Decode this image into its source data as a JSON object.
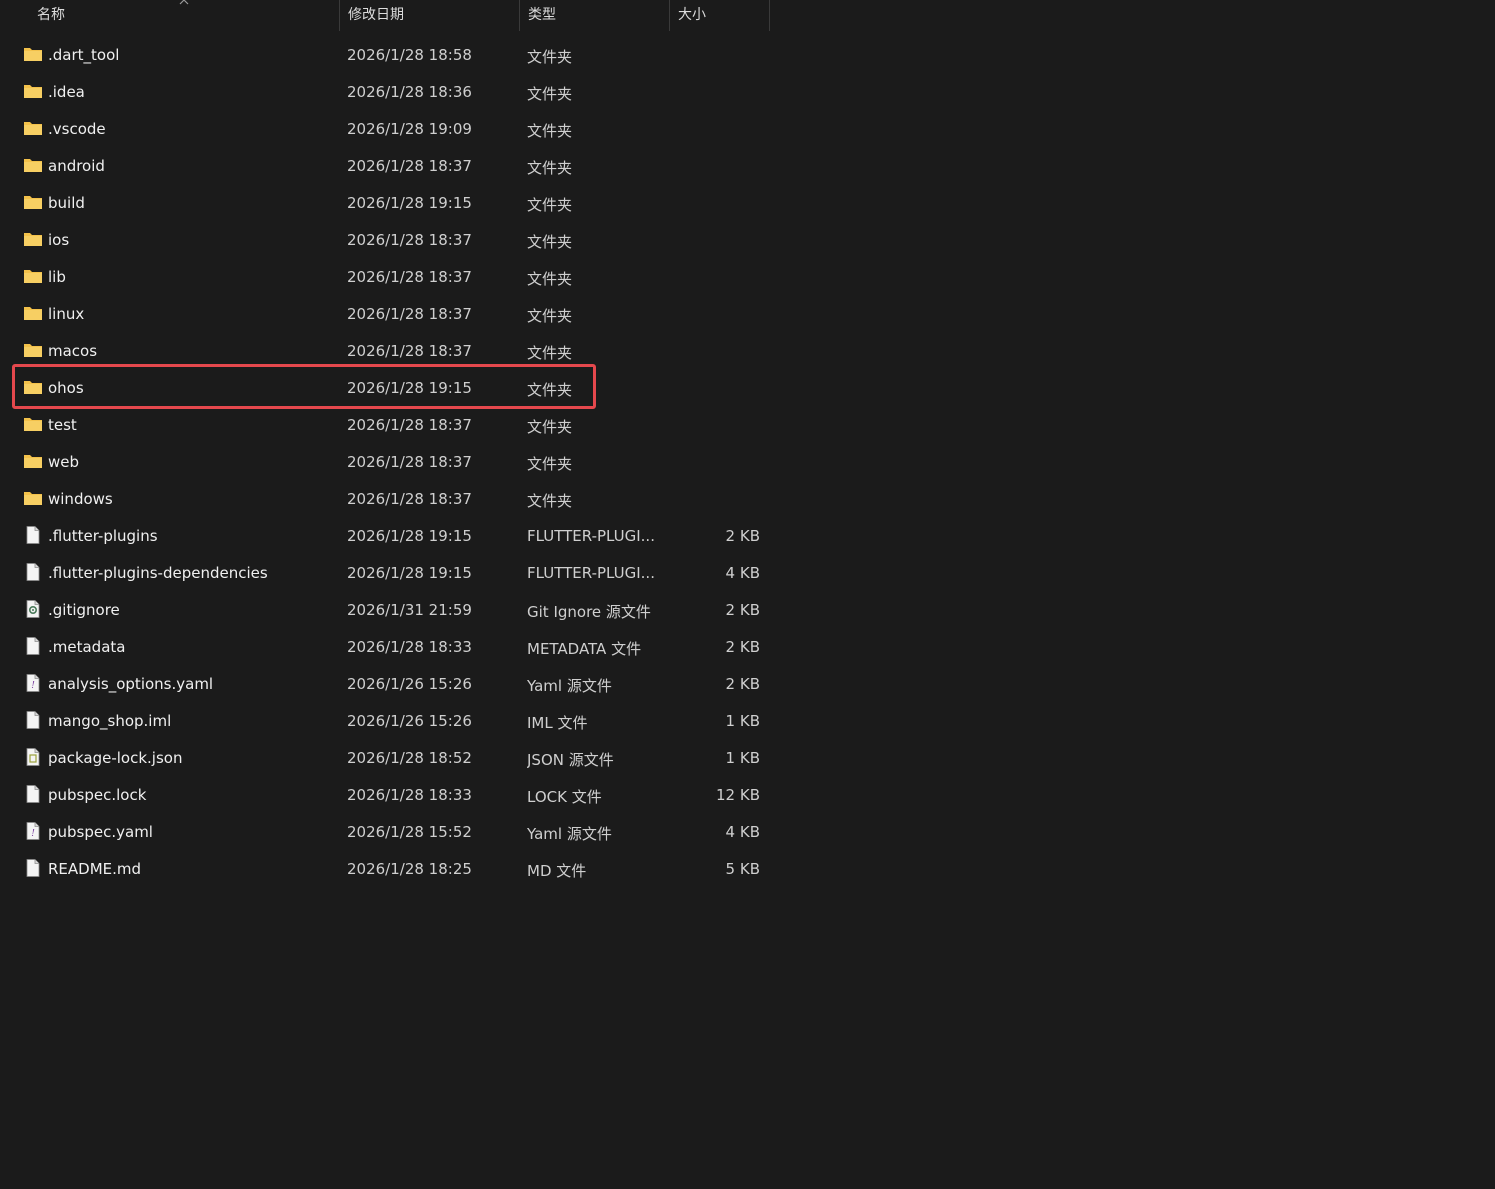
{
  "columns": {
    "name": "名称",
    "date": "修改日期",
    "type": "类型",
    "size": "大小"
  },
  "highlight_color": "#e5484d",
  "folder_color": "#f3c14a",
  "files": [
    {
      "name": ".dart_tool",
      "date": "2026/1/28 18:58",
      "type": "文件夹",
      "size": "",
      "icon": "folder-icon"
    },
    {
      "name": ".idea",
      "date": "2026/1/28 18:36",
      "type": "文件夹",
      "size": "",
      "icon": "folder-icon"
    },
    {
      "name": ".vscode",
      "date": "2026/1/28 19:09",
      "type": "文件夹",
      "size": "",
      "icon": "folder-icon"
    },
    {
      "name": "android",
      "date": "2026/1/28 18:37",
      "type": "文件夹",
      "size": "",
      "icon": "folder-icon"
    },
    {
      "name": "build",
      "date": "2026/1/28 19:15",
      "type": "文件夹",
      "size": "",
      "icon": "folder-icon"
    },
    {
      "name": "ios",
      "date": "2026/1/28 18:37",
      "type": "文件夹",
      "size": "",
      "icon": "folder-icon"
    },
    {
      "name": "lib",
      "date": "2026/1/28 18:37",
      "type": "文件夹",
      "size": "",
      "icon": "folder-icon"
    },
    {
      "name": "linux",
      "date": "2026/1/28 18:37",
      "type": "文件夹",
      "size": "",
      "icon": "folder-icon"
    },
    {
      "name": "macos",
      "date": "2026/1/28 18:37",
      "type": "文件夹",
      "size": "",
      "icon": "folder-icon"
    },
    {
      "name": "ohos",
      "date": "2026/1/28 19:15",
      "type": "文件夹",
      "size": "",
      "icon": "folder-icon"
    },
    {
      "name": "test",
      "date": "2026/1/28 18:37",
      "type": "文件夹",
      "size": "",
      "icon": "folder-icon"
    },
    {
      "name": "web",
      "date": "2026/1/28 18:37",
      "type": "文件夹",
      "size": "",
      "icon": "folder-icon"
    },
    {
      "name": "windows",
      "date": "2026/1/28 18:37",
      "type": "文件夹",
      "size": "",
      "icon": "folder-icon"
    },
    {
      "name": ".flutter-plugins",
      "date": "2026/1/28 19:15",
      "type": "FLUTTER-PLUGI...",
      "size": "2 KB",
      "icon": "file-icon"
    },
    {
      "name": ".flutter-plugins-dependencies",
      "date": "2026/1/28 19:15",
      "type": "FLUTTER-PLUGI...",
      "size": "4 KB",
      "icon": "file-icon"
    },
    {
      "name": ".gitignore",
      "date": "2026/1/31 21:59",
      "type": "Git Ignore 源文件",
      "size": "2 KB",
      "icon": "gear-file-icon"
    },
    {
      "name": ".metadata",
      "date": "2026/1/28 18:33",
      "type": "METADATA 文件",
      "size": "2 KB",
      "icon": "file-icon"
    },
    {
      "name": "analysis_options.yaml",
      "date": "2026/1/26 15:26",
      "type": "Yaml 源文件",
      "size": "2 KB",
      "icon": "yaml-file-icon"
    },
    {
      "name": "mango_shop.iml",
      "date": "2026/1/26 15:26",
      "type": "IML 文件",
      "size": "1 KB",
      "icon": "file-icon"
    },
    {
      "name": "package-lock.json",
      "date": "2026/1/28 18:52",
      "type": "JSON 源文件",
      "size": "1 KB",
      "icon": "json-file-icon"
    },
    {
      "name": "pubspec.lock",
      "date": "2026/1/28 18:33",
      "type": "LOCK 文件",
      "size": "12 KB",
      "icon": "file-icon"
    },
    {
      "name": "pubspec.yaml",
      "date": "2026/1/28 15:52",
      "type": "Yaml 源文件",
      "size": "4 KB",
      "icon": "yaml-file-icon"
    },
    {
      "name": "README.md",
      "date": "2026/1/28 18:25",
      "type": "MD 文件",
      "size": "5 KB",
      "icon": "file-icon"
    }
  ]
}
